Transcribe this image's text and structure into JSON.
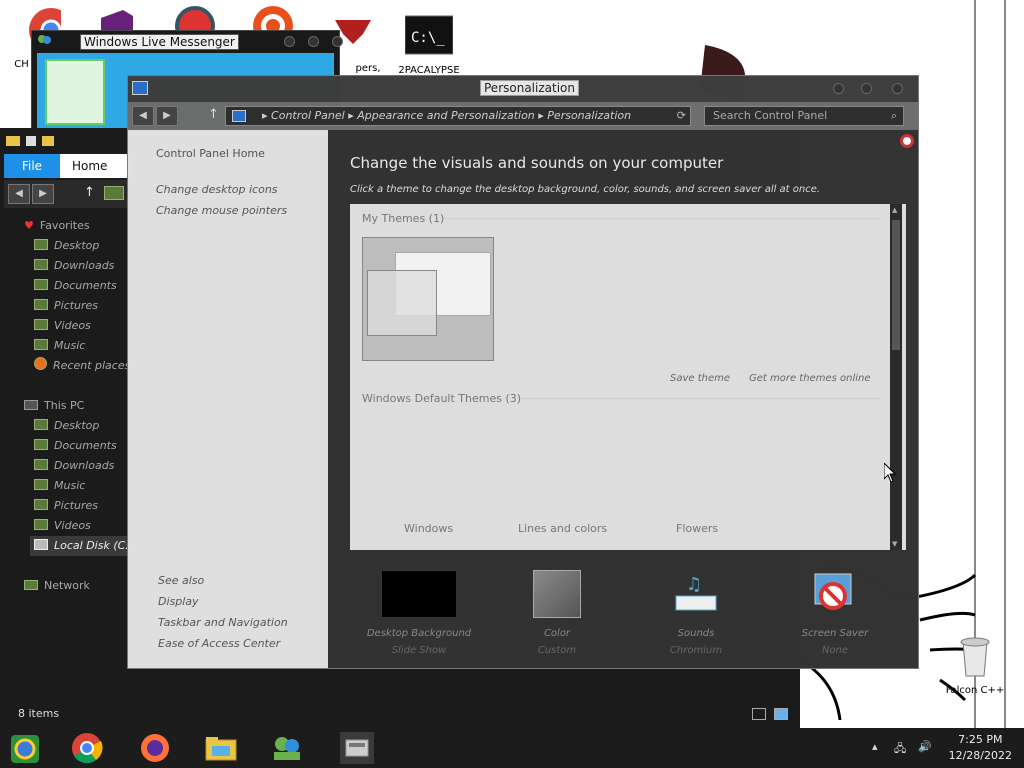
{
  "desktop": {
    "icons": [
      {
        "label": "CH D"
      },
      {
        "label": "pers,"
      },
      {
        "label": "2PACALYPSE"
      },
      {
        "label": "Falcon C++"
      }
    ]
  },
  "messenger": {
    "title": "Windows Live Messenger"
  },
  "explorer": {
    "ribbon": {
      "file": "File",
      "home": "Home"
    },
    "favorites": {
      "header": "Favorites",
      "items": [
        "Desktop",
        "Downloads",
        "Documents",
        "Pictures",
        "Videos",
        "Music",
        "Recent places"
      ]
    },
    "this_pc": {
      "header": "This PC",
      "items": [
        "Desktop",
        "Documents",
        "Downloads",
        "Music",
        "Pictures",
        "Videos",
        "Local Disk (C:)"
      ]
    },
    "network": "Network",
    "status": "8 items"
  },
  "personalization": {
    "title": "Personalization",
    "breadcrumb": [
      "Control Panel",
      "Appearance and Personalization",
      "Personalization"
    ],
    "search_placeholder": "Search Control Panel",
    "sidebar": {
      "home": "Control Panel Home",
      "links": [
        "Change desktop icons",
        "Change mouse pointers"
      ],
      "see_also_header": "See also",
      "see_also": [
        "Display",
        "Taskbar and Navigation",
        "Ease of Access Center"
      ]
    },
    "heading": "Change the visuals and sounds on your computer",
    "subheading": "Click a theme to change the desktop background, color, sounds, and screen saver all at once.",
    "my_themes": "My Themes (1)",
    "save_theme": "Save theme",
    "get_more": "Get more themes online",
    "default_themes": "Windows Default Themes (3)",
    "default_theme_names": [
      "Windows",
      "Lines and colors",
      "Flowers"
    ],
    "options": [
      {
        "title": "Desktop Background",
        "sub": "Slide Show"
      },
      {
        "title": "Color",
        "sub": "Custom"
      },
      {
        "title": "Sounds",
        "sub": "Chromium"
      },
      {
        "title": "Screen Saver",
        "sub": "None"
      }
    ]
  },
  "taskbar": {
    "time": "7:25 PM",
    "date": "12/28/2022"
  },
  "colors": {
    "accent_blue": "#1e90e8",
    "explorer_bg": "#1b1b1b",
    "taskbar_bg": "#1c1c1c"
  }
}
